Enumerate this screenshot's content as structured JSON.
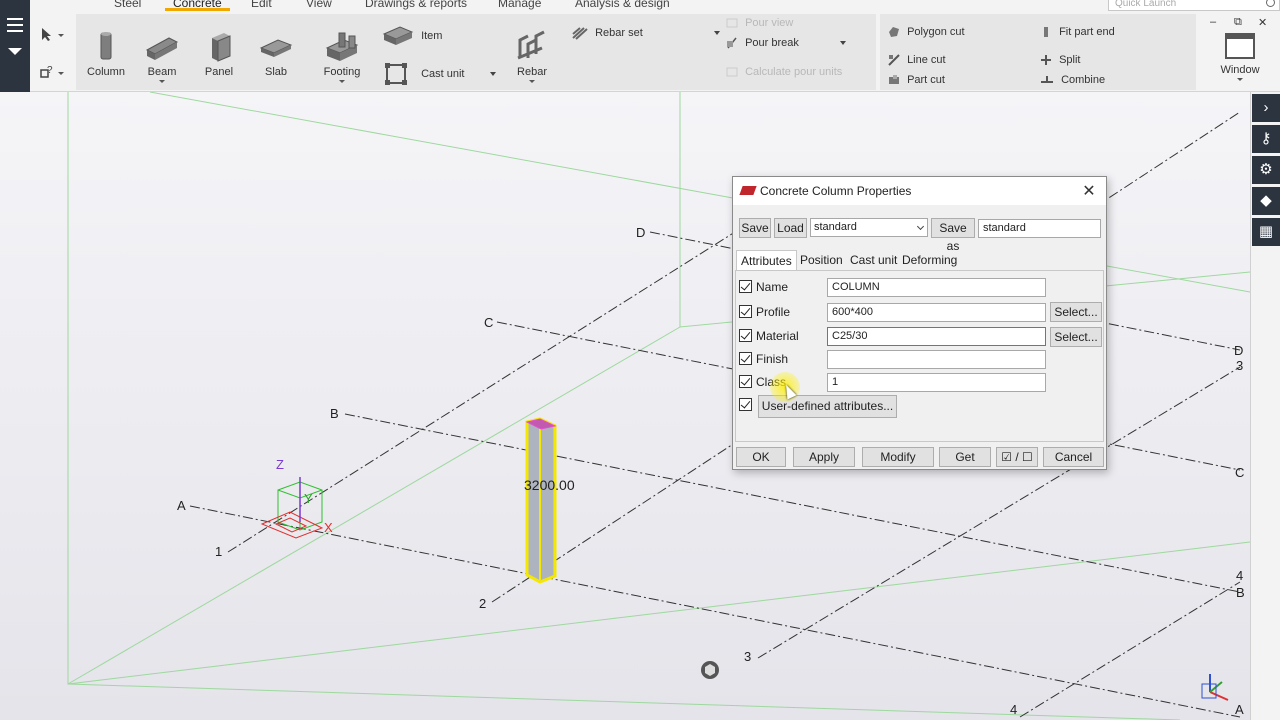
{
  "ribbon": {
    "tabs": [
      {
        "label": "Steel",
        "active": false
      },
      {
        "label": "Concrete",
        "active": true
      },
      {
        "label": "Edit",
        "active": false
      },
      {
        "label": "View",
        "active": false
      },
      {
        "label": "Drawings & reports",
        "active": false
      },
      {
        "label": "Manage",
        "active": false
      },
      {
        "label": "Analysis & design",
        "active": false
      }
    ],
    "quick_launch_placeholder": "Quick Launch",
    "accent_color": "#f0a800",
    "concrete": {
      "column": "Column",
      "beam": "Beam",
      "panel": "Panel",
      "slab": "Slab",
      "footing": "Footing",
      "item": "Item",
      "cast_unit": "Cast unit",
      "rebar": "Rebar",
      "rebar_set": "Rebar set",
      "pour_view": "Pour view",
      "pour_break": "Pour break",
      "calculate_pour_units": "Calculate pour units"
    },
    "edit": {
      "polygon_cut": "Polygon cut",
      "line_cut": "Line cut",
      "part_cut": "Part cut",
      "fit_part_end": "Fit part end",
      "split": "Split",
      "combine": "Combine"
    },
    "window": {
      "label": "Window"
    }
  },
  "viewport": {
    "grid_labels": {
      "a": "A",
      "b": "B",
      "c": "C",
      "d": "D",
      "n1": "1",
      "n2": "2",
      "n3": "3",
      "n4": "4"
    },
    "column_length": "3200.00",
    "axes": {
      "x": "X",
      "y": "Y",
      "z": "Z"
    }
  },
  "right_toolbar": {
    "icons": [
      "chevron-right-icon",
      "key-settings-icon",
      "gear-icon",
      "cube-icon",
      "layout-icon"
    ]
  },
  "dialog": {
    "title": "Concrete Column Properties",
    "close_glyph": "✕",
    "save": "Save",
    "load": "Load",
    "preset_value": "standard",
    "save_as": "Save as",
    "save_as_value": "standard",
    "tabs": [
      {
        "label": "Attributes",
        "active": true
      },
      {
        "label": "Position",
        "active": false
      },
      {
        "label": "Cast unit",
        "active": false
      },
      {
        "label": "Deforming",
        "active": false
      }
    ],
    "fields": {
      "name": {
        "label": "Name",
        "value": "COLUMN"
      },
      "profile": {
        "label": "Profile",
        "value": "600*400",
        "button": "Select..."
      },
      "material": {
        "label": "Material",
        "value": "C25/30",
        "button": "Select..."
      },
      "finish": {
        "label": "Finish",
        "value": ""
      },
      "class": {
        "label": "Class",
        "value": "1"
      }
    },
    "user_defined": "User-defined attributes...",
    "buttons": {
      "ok": "OK",
      "apply": "Apply",
      "modify": "Modify",
      "get": "Get",
      "toggle": "☑ / ☐",
      "cancel": "Cancel"
    }
  }
}
